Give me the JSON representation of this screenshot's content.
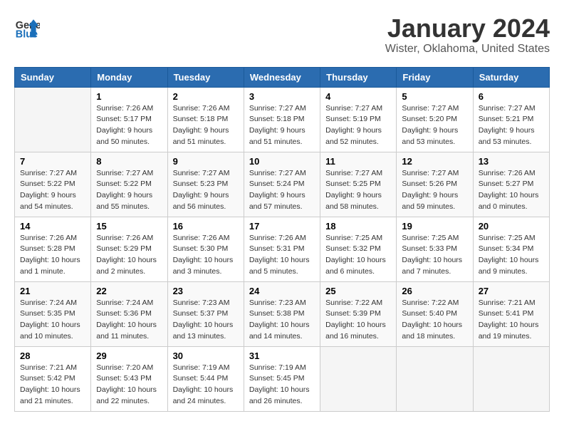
{
  "header": {
    "logo_line1": "General",
    "logo_line2": "Blue",
    "month": "January 2024",
    "location": "Wister, Oklahoma, United States"
  },
  "weekdays": [
    "Sunday",
    "Monday",
    "Tuesday",
    "Wednesday",
    "Thursday",
    "Friday",
    "Saturday"
  ],
  "weeks": [
    [
      {
        "day": "",
        "info": ""
      },
      {
        "day": "1",
        "info": "Sunrise: 7:26 AM\nSunset: 5:17 PM\nDaylight: 9 hours\nand 50 minutes."
      },
      {
        "day": "2",
        "info": "Sunrise: 7:26 AM\nSunset: 5:18 PM\nDaylight: 9 hours\nand 51 minutes."
      },
      {
        "day": "3",
        "info": "Sunrise: 7:27 AM\nSunset: 5:18 PM\nDaylight: 9 hours\nand 51 minutes."
      },
      {
        "day": "4",
        "info": "Sunrise: 7:27 AM\nSunset: 5:19 PM\nDaylight: 9 hours\nand 52 minutes."
      },
      {
        "day": "5",
        "info": "Sunrise: 7:27 AM\nSunset: 5:20 PM\nDaylight: 9 hours\nand 53 minutes."
      },
      {
        "day": "6",
        "info": "Sunrise: 7:27 AM\nSunset: 5:21 PM\nDaylight: 9 hours\nand 53 minutes."
      }
    ],
    [
      {
        "day": "7",
        "info": "Sunrise: 7:27 AM\nSunset: 5:22 PM\nDaylight: 9 hours\nand 54 minutes."
      },
      {
        "day": "8",
        "info": "Sunrise: 7:27 AM\nSunset: 5:22 PM\nDaylight: 9 hours\nand 55 minutes."
      },
      {
        "day": "9",
        "info": "Sunrise: 7:27 AM\nSunset: 5:23 PM\nDaylight: 9 hours\nand 56 minutes."
      },
      {
        "day": "10",
        "info": "Sunrise: 7:27 AM\nSunset: 5:24 PM\nDaylight: 9 hours\nand 57 minutes."
      },
      {
        "day": "11",
        "info": "Sunrise: 7:27 AM\nSunset: 5:25 PM\nDaylight: 9 hours\nand 58 minutes."
      },
      {
        "day": "12",
        "info": "Sunrise: 7:27 AM\nSunset: 5:26 PM\nDaylight: 9 hours\nand 59 minutes."
      },
      {
        "day": "13",
        "info": "Sunrise: 7:26 AM\nSunset: 5:27 PM\nDaylight: 10 hours\nand 0 minutes."
      }
    ],
    [
      {
        "day": "14",
        "info": "Sunrise: 7:26 AM\nSunset: 5:28 PM\nDaylight: 10 hours\nand 1 minute."
      },
      {
        "day": "15",
        "info": "Sunrise: 7:26 AM\nSunset: 5:29 PM\nDaylight: 10 hours\nand 2 minutes."
      },
      {
        "day": "16",
        "info": "Sunrise: 7:26 AM\nSunset: 5:30 PM\nDaylight: 10 hours\nand 3 minutes."
      },
      {
        "day": "17",
        "info": "Sunrise: 7:26 AM\nSunset: 5:31 PM\nDaylight: 10 hours\nand 5 minutes."
      },
      {
        "day": "18",
        "info": "Sunrise: 7:25 AM\nSunset: 5:32 PM\nDaylight: 10 hours\nand 6 minutes."
      },
      {
        "day": "19",
        "info": "Sunrise: 7:25 AM\nSunset: 5:33 PM\nDaylight: 10 hours\nand 7 minutes."
      },
      {
        "day": "20",
        "info": "Sunrise: 7:25 AM\nSunset: 5:34 PM\nDaylight: 10 hours\nand 9 minutes."
      }
    ],
    [
      {
        "day": "21",
        "info": "Sunrise: 7:24 AM\nSunset: 5:35 PM\nDaylight: 10 hours\nand 10 minutes."
      },
      {
        "day": "22",
        "info": "Sunrise: 7:24 AM\nSunset: 5:36 PM\nDaylight: 10 hours\nand 11 minutes."
      },
      {
        "day": "23",
        "info": "Sunrise: 7:23 AM\nSunset: 5:37 PM\nDaylight: 10 hours\nand 13 minutes."
      },
      {
        "day": "24",
        "info": "Sunrise: 7:23 AM\nSunset: 5:38 PM\nDaylight: 10 hours\nand 14 minutes."
      },
      {
        "day": "25",
        "info": "Sunrise: 7:22 AM\nSunset: 5:39 PM\nDaylight: 10 hours\nand 16 minutes."
      },
      {
        "day": "26",
        "info": "Sunrise: 7:22 AM\nSunset: 5:40 PM\nDaylight: 10 hours\nand 18 minutes."
      },
      {
        "day": "27",
        "info": "Sunrise: 7:21 AM\nSunset: 5:41 PM\nDaylight: 10 hours\nand 19 minutes."
      }
    ],
    [
      {
        "day": "28",
        "info": "Sunrise: 7:21 AM\nSunset: 5:42 PM\nDaylight: 10 hours\nand 21 minutes."
      },
      {
        "day": "29",
        "info": "Sunrise: 7:20 AM\nSunset: 5:43 PM\nDaylight: 10 hours\nand 22 minutes."
      },
      {
        "day": "30",
        "info": "Sunrise: 7:19 AM\nSunset: 5:44 PM\nDaylight: 10 hours\nand 24 minutes."
      },
      {
        "day": "31",
        "info": "Sunrise: 7:19 AM\nSunset: 5:45 PM\nDaylight: 10 hours\nand 26 minutes."
      },
      {
        "day": "",
        "info": ""
      },
      {
        "day": "",
        "info": ""
      },
      {
        "day": "",
        "info": ""
      }
    ]
  ]
}
